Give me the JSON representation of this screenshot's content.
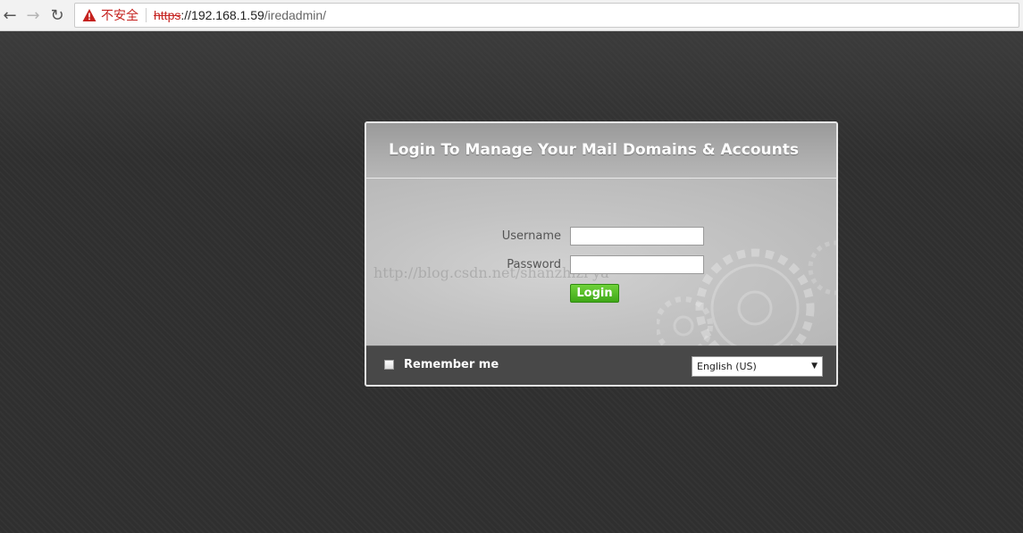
{
  "browser": {
    "back_icon": "arrow-left-icon",
    "forward_icon": "arrow-right-icon",
    "reload_icon": "reload-icon",
    "warning_icon": "warning-triangle-icon",
    "insecure_label": "不安全",
    "url_scheme": "https",
    "url_host": "://192.168.1.59",
    "url_path": "/iredadmin/"
  },
  "login": {
    "title": "Login To Manage Your Mail Domains & Accounts",
    "username_label": "Username",
    "password_label": "Password",
    "username_value": "",
    "password_value": "",
    "login_button": "Login",
    "remember_label": "Remember me",
    "remember_checked": false,
    "language_selected": "English (US)",
    "watermark": "http://blog.csdn.net/shanzhizi ya"
  },
  "colors": {
    "insecure": "#c5221f",
    "login_button": "#4cb822",
    "page_background": "#2f2f2f"
  }
}
